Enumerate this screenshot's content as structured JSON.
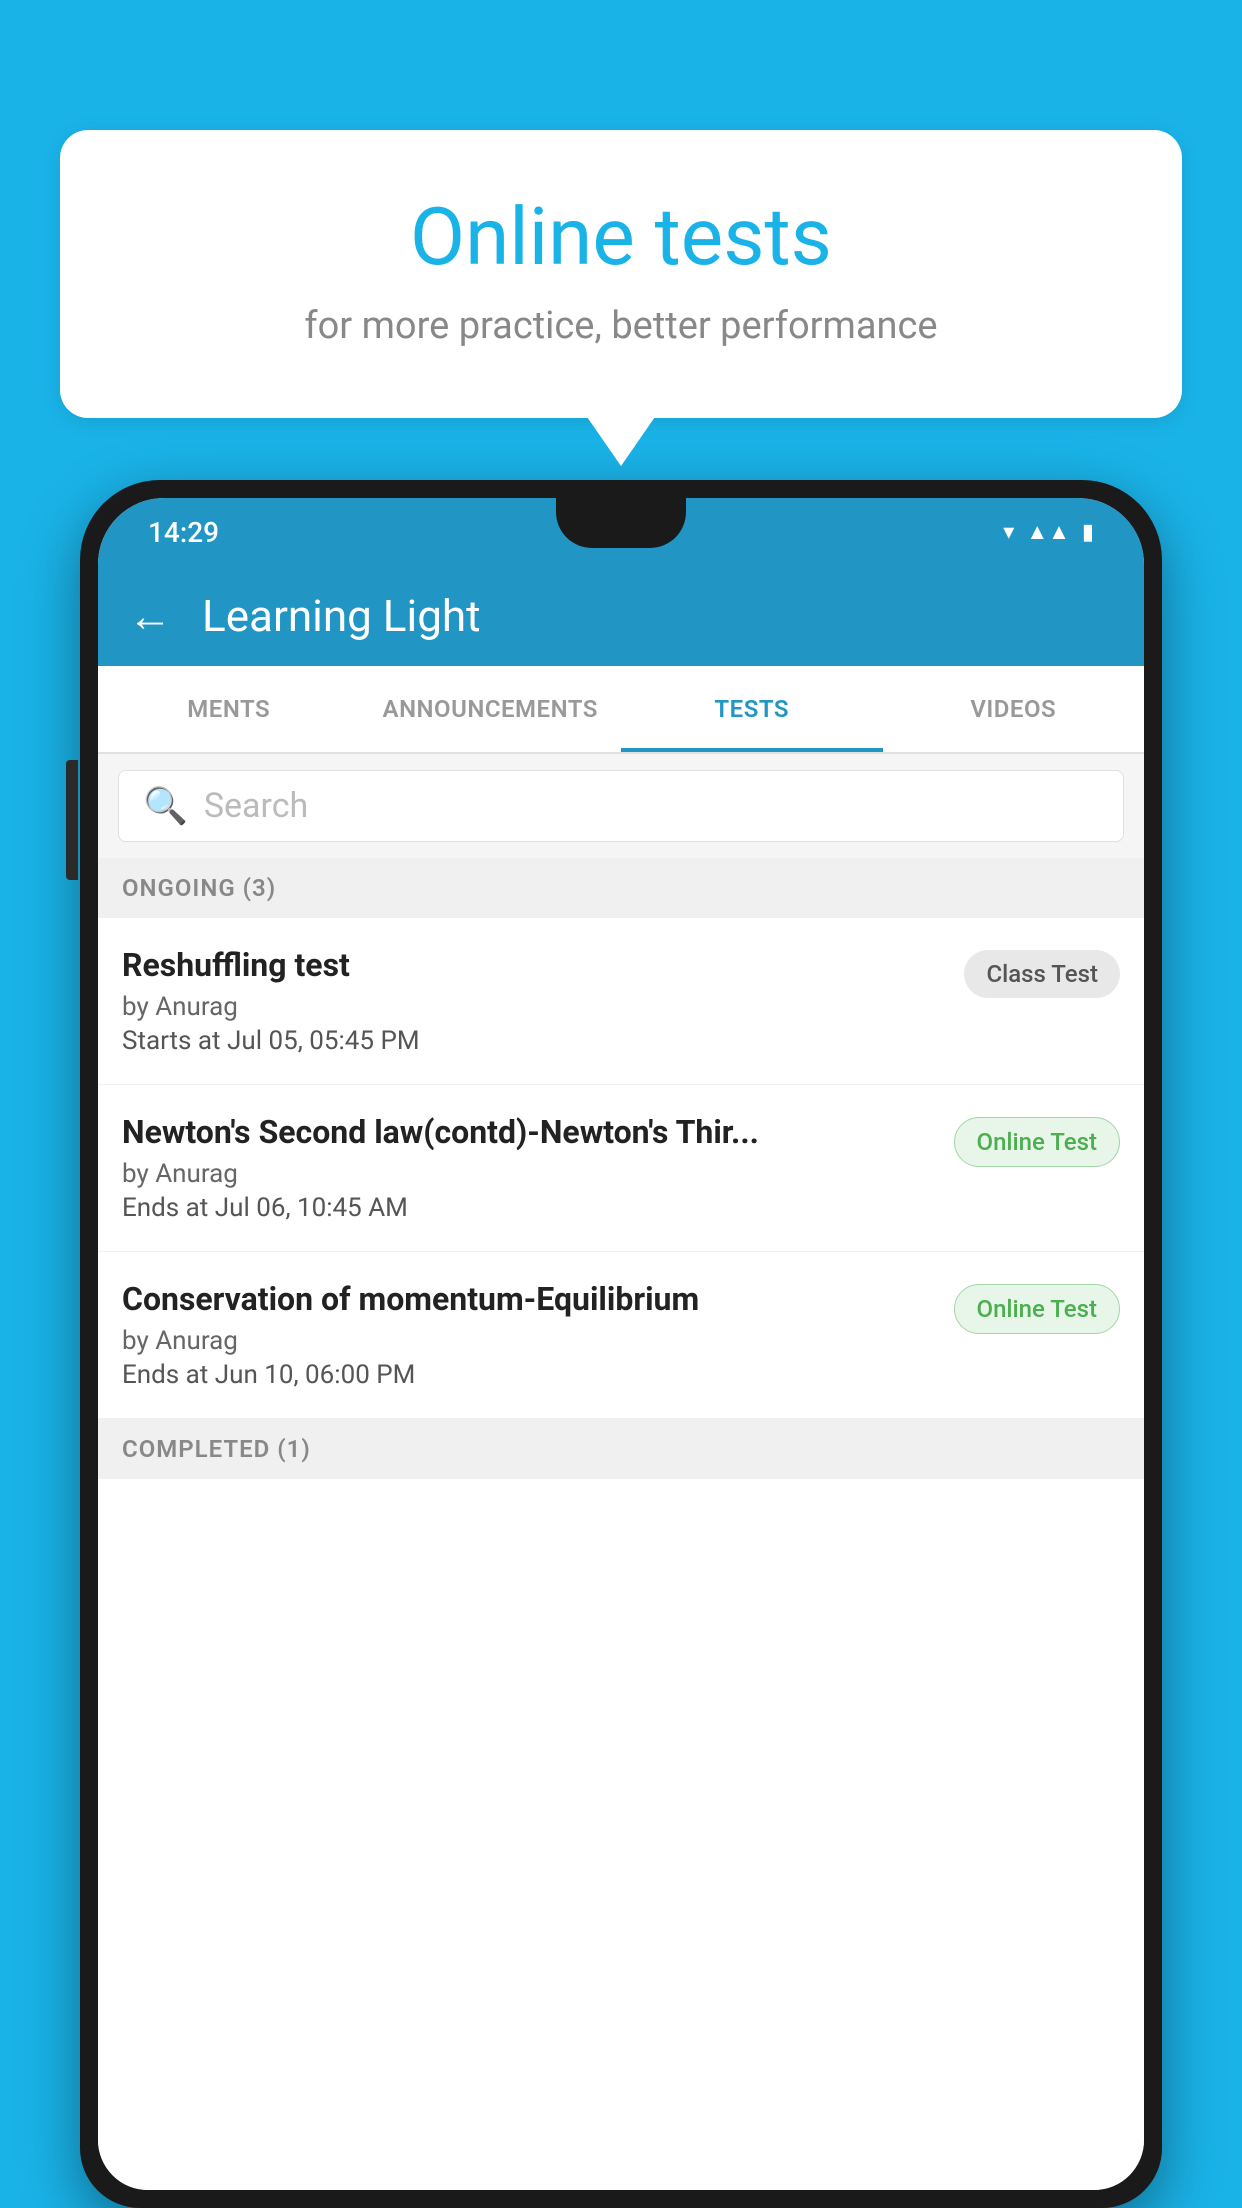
{
  "background_color": "#1ab3e8",
  "speech_bubble": {
    "title": "Online tests",
    "subtitle": "for more practice, better performance"
  },
  "phone": {
    "status_bar": {
      "time": "14:29",
      "icons": [
        "wifi",
        "signal",
        "battery"
      ]
    },
    "app_bar": {
      "title": "Learning Light",
      "back_label": "←"
    },
    "tabs": [
      {
        "label": "MENTS",
        "active": false
      },
      {
        "label": "ANNOUNCEMENTS",
        "active": false
      },
      {
        "label": "TESTS",
        "active": true
      },
      {
        "label": "VIDEOS",
        "active": false
      }
    ],
    "search": {
      "placeholder": "Search"
    },
    "sections": [
      {
        "header": "ONGOING (3)",
        "items": [
          {
            "name": "Reshuffling test",
            "author": "by Anurag",
            "time_label": "Starts at",
            "time": "Jul 05, 05:45 PM",
            "badge": "Class Test",
            "badge_type": "class"
          },
          {
            "name": "Newton's Second law(contd)-Newton's Thir...",
            "author": "by Anurag",
            "time_label": "Ends at",
            "time": "Jul 06, 10:45 AM",
            "badge": "Online Test",
            "badge_type": "online"
          },
          {
            "name": "Conservation of momentum-Equilibrium",
            "author": "by Anurag",
            "time_label": "Ends at",
            "time": "Jun 10, 06:00 PM",
            "badge": "Online Test",
            "badge_type": "online"
          }
        ]
      }
    ],
    "completed_section_header": "COMPLETED (1)"
  }
}
